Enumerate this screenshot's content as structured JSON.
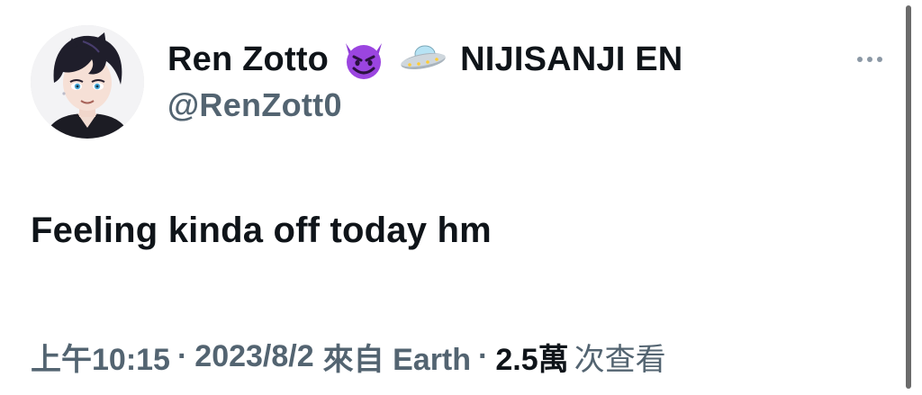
{
  "user": {
    "display_name": "Ren Zotto",
    "org_name": "NIJISANJI EN",
    "handle": "@RenZott0",
    "emoji_badges": [
      "smiling-devil-emoji",
      "flying-saucer-emoji"
    ]
  },
  "tweet": {
    "text": "Feeling kinda off today hm"
  },
  "meta": {
    "time": "上午10:15",
    "separator": "·",
    "date": "2023/8/2",
    "source": "來自 Earth",
    "views_count": "2.5萬",
    "views_label": "次查看"
  },
  "colors": {
    "text_primary": "#0f1419",
    "text_secondary": "#536471",
    "more_dots": "#8b98a5",
    "background": "#ffffff"
  }
}
